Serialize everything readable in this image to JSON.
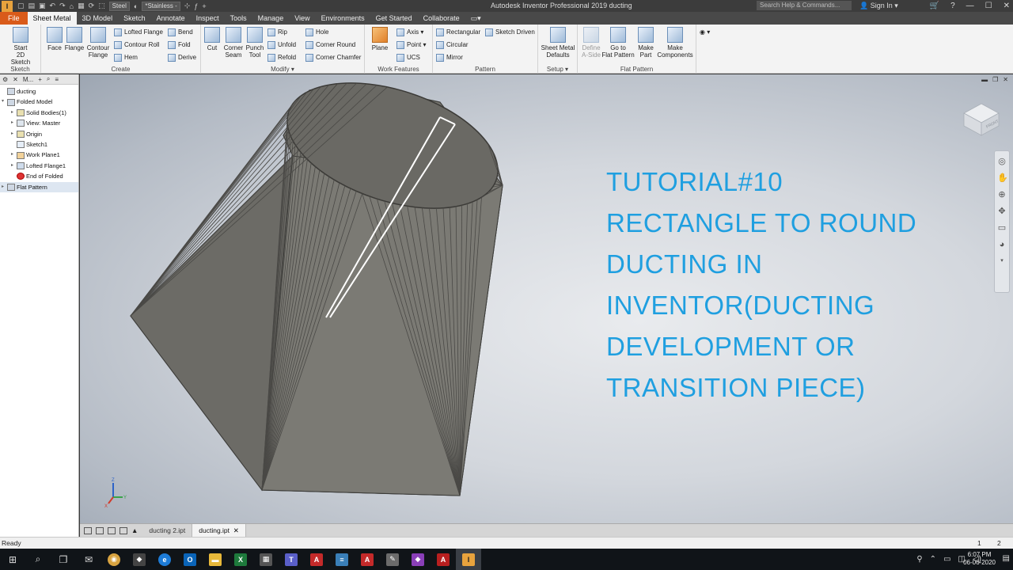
{
  "titlebar": {
    "material": "Steel",
    "appearance": "*Stainless -",
    "title": "Autodesk Inventor Professional 2019   ducting",
    "search_placeholder": "Search Help & Commands...",
    "signin": "Sign In"
  },
  "tabs": [
    "File",
    "Sheet Metal",
    "3D Model",
    "Sketch",
    "Annotate",
    "Inspect",
    "Tools",
    "Manage",
    "View",
    "Environments",
    "Get Started",
    "Collaborate"
  ],
  "ribbon": {
    "sketch": {
      "start": "Start",
      "sketch2d": "2D Sketch",
      "label": "Sketch"
    },
    "create": {
      "face": "Face",
      "flange": "Flange",
      "contour": "Contour",
      "contour_flange": "Flange",
      "lofted_flange": "Lofted Flange",
      "contour_roll": "Contour Roll",
      "hem": "Hem",
      "bend": "Bend",
      "fold": "Fold",
      "derive": "Derive",
      "label": "Create"
    },
    "modify": {
      "cut": "Cut",
      "corner": "Corner",
      "seam": "Seam",
      "punch": "Punch",
      "tool": "Tool",
      "rip": "Rip",
      "unfold": "Unfold",
      "refold": "Refold",
      "hole": "Hole",
      "corner_round": "Corner Round",
      "corner_chamfer": "Corner Chamfer",
      "label": "Modify"
    },
    "work_features": {
      "plane": "Plane",
      "axis": "Axis",
      "point": "Point",
      "ucs": "UCS",
      "label": "Work Features"
    },
    "pattern": {
      "rectangular": "Rectangular",
      "sketch_driven": "Sketch Driven",
      "circular": "Circular",
      "mirror": "Mirror",
      "label": "Pattern"
    },
    "setup": {
      "sheet_metal": "Sheet Metal",
      "defaults": "Defaults",
      "label": "Setup"
    },
    "flat_pattern": {
      "define": "Define",
      "a_side": "A-Side",
      "goto": "Go to",
      "goto2": "Flat Pattern",
      "make": "Make",
      "part": "Part",
      "make2": "Make",
      "components": "Components",
      "label": "Flat Pattern"
    }
  },
  "browser": {
    "tab": "M...",
    "nodes": [
      "ducting",
      "Folded Model",
      "Solid Bodies(1)",
      "View: Master",
      "Origin",
      "Sketch1",
      "Work Plane1",
      "Lofted Flange1",
      "End of Folded",
      "Flat Pattern"
    ]
  },
  "viewport": {
    "tutorial_lines": [
      "TUTORIAL#10",
      "RECTANGLE TO ROUND",
      "DUCTING IN",
      "INVENTOR(DUCTING",
      "DEVELOPMENT OR",
      "TRANSITION PIECE)"
    ],
    "viewcube_face": "FRONT",
    "triad_x": "X",
    "triad_y": "Y",
    "triad_z": "Z"
  },
  "doctabs": [
    "ducting 2.ipt",
    "ducting.ipt"
  ],
  "status": {
    "text": "Ready",
    "n1": "1",
    "n2": "2"
  },
  "clock": {
    "time": "6:07 PM",
    "date": "06-06-2020"
  },
  "colors": {
    "accent_file": "#d95b1a",
    "tutorial_text": "#1f9fe0",
    "model_fill": "#777670"
  }
}
